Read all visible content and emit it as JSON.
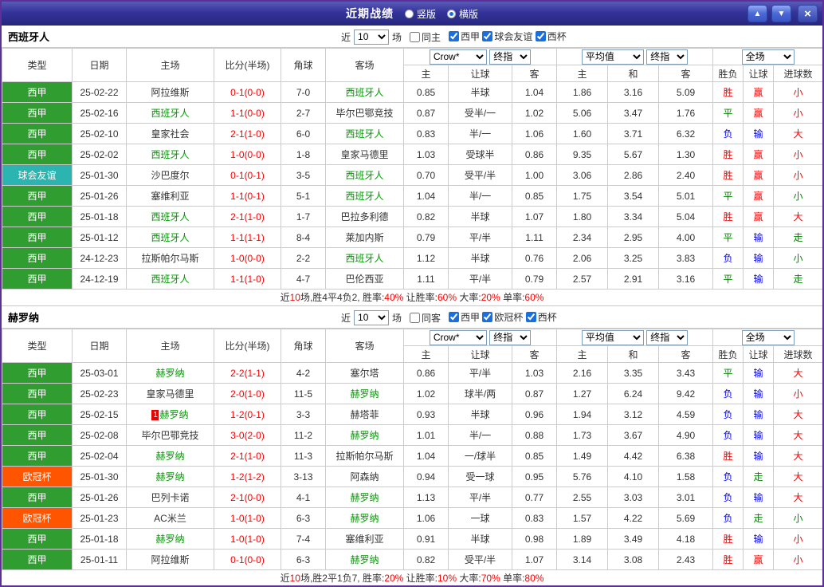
{
  "titlebar": {
    "title": "近期战绩",
    "radios": [
      {
        "label": "竖版",
        "selected": false
      },
      {
        "label": "横版",
        "selected": true
      }
    ],
    "buttons": {
      "up": "▲",
      "down": "▼",
      "close": "×"
    }
  },
  "filter": {
    "near_label": "近",
    "count": "10",
    "matches_label": "场"
  },
  "columns": {
    "type": "类型",
    "date": "日期",
    "home": "主场",
    "score_half": "比分(半场)",
    "corners": "角球",
    "away": "客场",
    "company_select": "Crow*",
    "final_select": "终指",
    "avg_select": "平均值",
    "scope_select": "全场",
    "odds_home": "主",
    "odds_handicap": "让球",
    "odds_away": "客",
    "avg_home": "主",
    "avg_draw": "和",
    "avg_away": "客",
    "result": "胜负",
    "handicap_result": "让球",
    "goals": "进球数"
  },
  "colors": {
    "laliga_bg": "#2f9d2f",
    "friendly_bg": "#2cb5b0",
    "ucl_bg": "#ff5500",
    "focal_team": "#009900",
    "score": "#ff0000",
    "win_red": "#ff0000",
    "draw_green": "#008800",
    "lose_blue": "#0000ee",
    "titlebar_bg": "#33339a",
    "page_border": "#5e2f96"
  },
  "tables": [
    {
      "team": "西班牙人",
      "same_venue_label": "同主",
      "same_venue_checked": false,
      "leagues": [
        {
          "label": "西甲",
          "checked": true
        },
        {
          "label": "球会友谊",
          "checked": true
        },
        {
          "label": "西杯",
          "checked": true
        }
      ],
      "rows": [
        {
          "league": "西甲",
          "league_color": "laliga",
          "date": "25-02-22",
          "home": "阿拉维斯",
          "home_color": "",
          "badge": "",
          "score": "0-1(0-0)",
          "corners": "7-0",
          "away": "西班牙人",
          "away_color": "focal",
          "odds": [
            "0.85",
            "半球",
            "1.04"
          ],
          "avg": [
            "1.86",
            "3.16",
            "5.09"
          ],
          "res": [
            {
              "t": "胜",
              "c": "red"
            },
            {
              "t": "赢",
              "c": "red"
            },
            {
              "t": "小",
              "c": "red"
            }
          ]
        },
        {
          "league": "西甲",
          "league_color": "laliga",
          "date": "25-02-16",
          "home": "西班牙人",
          "home_color": "focal",
          "badge": "",
          "score": "1-1(0-0)",
          "corners": "2-7",
          "away": "毕尔巴鄂竞技",
          "away_color": "",
          "odds": [
            "0.87",
            "受半/一",
            "1.02"
          ],
          "avg": [
            "5.06",
            "3.47",
            "1.76"
          ],
          "res": [
            {
              "t": "平",
              "c": "green"
            },
            {
              "t": "赢",
              "c": "red"
            },
            {
              "t": "小",
              "c": "red"
            }
          ]
        },
        {
          "league": "西甲",
          "league_color": "laliga",
          "date": "25-02-10",
          "home": "皇家社会",
          "home_color": "",
          "badge": "",
          "score": "2-1(1-0)",
          "corners": "6-0",
          "away": "西班牙人",
          "away_color": "focal",
          "odds": [
            "0.83",
            "半/一",
            "1.06"
          ],
          "avg": [
            "1.60",
            "3.71",
            "6.32"
          ],
          "res": [
            {
              "t": "负",
              "c": "blue"
            },
            {
              "t": "输",
              "c": "blue"
            },
            {
              "t": "大",
              "c": "red"
            }
          ]
        },
        {
          "league": "西甲",
          "league_color": "laliga",
          "date": "25-02-02",
          "home": "西班牙人",
          "home_color": "focal",
          "badge": "",
          "score": "1-0(0-0)",
          "corners": "1-8",
          "away": "皇家马德里",
          "away_color": "",
          "odds": [
            "1.03",
            "受球半",
            "0.86"
          ],
          "avg": [
            "9.35",
            "5.67",
            "1.30"
          ],
          "res": [
            {
              "t": "胜",
              "c": "red"
            },
            {
              "t": "赢",
              "c": "red"
            },
            {
              "t": "小",
              "c": "red"
            }
          ]
        },
        {
          "league": "球会友谊",
          "league_color": "friendly",
          "date": "25-01-30",
          "home": "沙巴度尔",
          "home_color": "",
          "badge": "",
          "score": "0-1(0-1)",
          "corners": "3-5",
          "away": "西班牙人",
          "away_color": "focal",
          "odds": [
            "0.70",
            "受平/半",
            "1.00"
          ],
          "avg": [
            "3.06",
            "2.86",
            "2.40"
          ],
          "res": [
            {
              "t": "胜",
              "c": "red"
            },
            {
              "t": "赢",
              "c": "red"
            },
            {
              "t": "小",
              "c": "red"
            }
          ]
        },
        {
          "league": "西甲",
          "league_color": "laliga",
          "date": "25-01-26",
          "home": "塞维利亚",
          "home_color": "",
          "badge": "",
          "score": "1-1(0-1)",
          "corners": "5-1",
          "away": "西班牙人",
          "away_color": "focal",
          "odds": [
            "1.04",
            "半/一",
            "0.85"
          ],
          "avg": [
            "1.75",
            "3.54",
            "5.01"
          ],
          "res": [
            {
              "t": "平",
              "c": "green"
            },
            {
              "t": "赢",
              "c": "red"
            },
            {
              "t": "小",
              "c": "green"
            }
          ]
        },
        {
          "league": "西甲",
          "league_color": "laliga",
          "date": "25-01-18",
          "home": "西班牙人",
          "home_color": "focal",
          "badge": "",
          "score": "2-1(1-0)",
          "corners": "1-7",
          "away": "巴拉多利德",
          "away_color": "",
          "odds": [
            "0.82",
            "半球",
            "1.07"
          ],
          "avg": [
            "1.80",
            "3.34",
            "5.04"
          ],
          "res": [
            {
              "t": "胜",
              "c": "red"
            },
            {
              "t": "赢",
              "c": "red"
            },
            {
              "t": "大",
              "c": "red"
            }
          ]
        },
        {
          "league": "西甲",
          "league_color": "laliga",
          "date": "25-01-12",
          "home": "西班牙人",
          "home_color": "focal",
          "badge": "",
          "score": "1-1(1-1)",
          "corners": "8-4",
          "away": "莱加内斯",
          "away_color": "",
          "odds": [
            "0.79",
            "平/半",
            "1.11"
          ],
          "avg": [
            "2.34",
            "2.95",
            "4.00"
          ],
          "res": [
            {
              "t": "平",
              "c": "green"
            },
            {
              "t": "输",
              "c": "blue"
            },
            {
              "t": "走",
              "c": "green"
            }
          ]
        },
        {
          "league": "西甲",
          "league_color": "laliga",
          "date": "24-12-23",
          "home": "拉斯帕尔马斯",
          "home_color": "",
          "badge": "",
          "score": "1-0(0-0)",
          "corners": "2-2",
          "away": "西班牙人",
          "away_color": "focal",
          "odds": [
            "1.12",
            "半球",
            "0.76"
          ],
          "avg": [
            "2.06",
            "3.25",
            "3.83"
          ],
          "res": [
            {
              "t": "负",
              "c": "blue"
            },
            {
              "t": "输",
              "c": "blue"
            },
            {
              "t": "小",
              "c": "green"
            }
          ]
        },
        {
          "league": "西甲",
          "league_color": "laliga",
          "date": "24-12-19",
          "home": "西班牙人",
          "home_color": "focal",
          "badge": "",
          "score": "1-1(1-0)",
          "corners": "4-7",
          "away": "巴伦西亚",
          "away_color": "",
          "odds": [
            "1.11",
            "平/半",
            "0.79"
          ],
          "avg": [
            "2.57",
            "2.91",
            "3.16"
          ],
          "res": [
            {
              "t": "平",
              "c": "green"
            },
            {
              "t": "输",
              "c": "blue"
            },
            {
              "t": "走",
              "c": "green"
            }
          ]
        }
      ],
      "footer": [
        {
          "t": "近",
          "c": "k"
        },
        {
          "t": "10",
          "c": "r"
        },
        {
          "t": "场,胜4平4负2, 胜率:",
          "c": "k"
        },
        {
          "t": "40%",
          "c": "r"
        },
        {
          "t": " 让胜率:",
          "c": "k"
        },
        {
          "t": "60%",
          "c": "r"
        },
        {
          "t": " 大率:",
          "c": "k"
        },
        {
          "t": "20%",
          "c": "r"
        },
        {
          "t": " 单率:",
          "c": "k"
        },
        {
          "t": "60%",
          "c": "r"
        }
      ]
    },
    {
      "team": "赫罗纳",
      "same_venue_label": "同客",
      "same_venue_checked": false,
      "leagues": [
        {
          "label": "西甲",
          "checked": true
        },
        {
          "label": "欧冠杯",
          "checked": true
        },
        {
          "label": "西杯",
          "checked": true
        }
      ],
      "rows": [
        {
          "league": "西甲",
          "league_color": "laliga",
          "date": "25-03-01",
          "home": "赫罗纳",
          "home_color": "focal",
          "badge": "",
          "score": "2-2(1-1)",
          "corners": "4-2",
          "away": "塞尔塔",
          "away_color": "",
          "odds": [
            "0.86",
            "平/半",
            "1.03"
          ],
          "avg": [
            "2.16",
            "3.35",
            "3.43"
          ],
          "res": [
            {
              "t": "平",
              "c": "green"
            },
            {
              "t": "输",
              "c": "blue"
            },
            {
              "t": "大",
              "c": "red"
            }
          ]
        },
        {
          "league": "西甲",
          "league_color": "laliga",
          "date": "25-02-23",
          "home": "皇家马德里",
          "home_color": "",
          "badge": "",
          "score": "2-0(1-0)",
          "corners": "11-5",
          "away": "赫罗纳",
          "away_color": "focal",
          "odds": [
            "1.02",
            "球半/两",
            "0.87"
          ],
          "avg": [
            "1.27",
            "6.24",
            "9.42"
          ],
          "res": [
            {
              "t": "负",
              "c": "blue"
            },
            {
              "t": "输",
              "c": "blue"
            },
            {
              "t": "小",
              "c": "red"
            }
          ]
        },
        {
          "league": "西甲",
          "league_color": "laliga",
          "date": "25-02-15",
          "home": "赫罗纳",
          "home_color": "focal",
          "badge": "1",
          "score": "1-2(0-1)",
          "corners": "3-3",
          "away": "赫塔菲",
          "away_color": "",
          "odds": [
            "0.93",
            "半球",
            "0.96"
          ],
          "avg": [
            "1.94",
            "3.12",
            "4.59"
          ],
          "res": [
            {
              "t": "负",
              "c": "blue"
            },
            {
              "t": "输",
              "c": "blue"
            },
            {
              "t": "大",
              "c": "red"
            }
          ]
        },
        {
          "league": "西甲",
          "league_color": "laliga",
          "date": "25-02-08",
          "home": "毕尔巴鄂竞技",
          "home_color": "",
          "badge": "",
          "score": "3-0(2-0)",
          "corners": "11-2",
          "away": "赫罗纳",
          "away_color": "focal",
          "odds": [
            "1.01",
            "半/一",
            "0.88"
          ],
          "avg": [
            "1.73",
            "3.67",
            "4.90"
          ],
          "res": [
            {
              "t": "负",
              "c": "blue"
            },
            {
              "t": "输",
              "c": "blue"
            },
            {
              "t": "大",
              "c": "red"
            }
          ]
        },
        {
          "league": "西甲",
          "league_color": "laliga",
          "date": "25-02-04",
          "home": "赫罗纳",
          "home_color": "focal",
          "badge": "",
          "score": "2-1(1-0)",
          "corners": "11-3",
          "away": "拉斯帕尔马斯",
          "away_color": "",
          "odds": [
            "1.04",
            "一/球半",
            "0.85"
          ],
          "avg": [
            "1.49",
            "4.42",
            "6.38"
          ],
          "res": [
            {
              "t": "胜",
              "c": "red"
            },
            {
              "t": "输",
              "c": "blue"
            },
            {
              "t": "大",
              "c": "red"
            }
          ]
        },
        {
          "league": "欧冠杯",
          "league_color": "ucl",
          "date": "25-01-30",
          "home": "赫罗纳",
          "home_color": "focal",
          "badge": "",
          "score": "1-2(1-2)",
          "corners": "3-13",
          "away": "阿森纳",
          "away_color": "",
          "odds": [
            "0.94",
            "受一球",
            "0.95"
          ],
          "avg": [
            "5.76",
            "4.10",
            "1.58"
          ],
          "res": [
            {
              "t": "负",
              "c": "blue"
            },
            {
              "t": "走",
              "c": "green"
            },
            {
              "t": "大",
              "c": "red"
            }
          ]
        },
        {
          "league": "西甲",
          "league_color": "laliga",
          "date": "25-01-26",
          "home": "巴列卡诺",
          "home_color": "",
          "badge": "",
          "score": "2-1(0-0)",
          "corners": "4-1",
          "away": "赫罗纳",
          "away_color": "focal",
          "odds": [
            "1.13",
            "平/半",
            "0.77"
          ],
          "avg": [
            "2.55",
            "3.03",
            "3.01"
          ],
          "res": [
            {
              "t": "负",
              "c": "blue"
            },
            {
              "t": "输",
              "c": "blue"
            },
            {
              "t": "大",
              "c": "red"
            }
          ]
        },
        {
          "league": "欧冠杯",
          "league_color": "ucl",
          "date": "25-01-23",
          "home": "AC米兰",
          "home_color": "",
          "badge": "",
          "score": "1-0(1-0)",
          "corners": "6-3",
          "away": "赫罗纳",
          "away_color": "focal",
          "odds": [
            "1.06",
            "一球",
            "0.83"
          ],
          "avg": [
            "1.57",
            "4.22",
            "5.69"
          ],
          "res": [
            {
              "t": "负",
              "c": "blue"
            },
            {
              "t": "走",
              "c": "green"
            },
            {
              "t": "小",
              "c": "green"
            }
          ]
        },
        {
          "league": "西甲",
          "league_color": "laliga",
          "date": "25-01-18",
          "home": "赫罗纳",
          "home_color": "focal",
          "badge": "",
          "score": "1-0(1-0)",
          "corners": "7-4",
          "away": "塞维利亚",
          "away_color": "",
          "odds": [
            "0.91",
            "半球",
            "0.98"
          ],
          "avg": [
            "1.89",
            "3.49",
            "4.18"
          ],
          "res": [
            {
              "t": "胜",
              "c": "red"
            },
            {
              "t": "输",
              "c": "blue"
            },
            {
              "t": "小",
              "c": "red"
            }
          ]
        },
        {
          "league": "西甲",
          "league_color": "laliga",
          "date": "25-01-11",
          "home": "阿拉维斯",
          "home_color": "",
          "badge": "",
          "score": "0-1(0-0)",
          "corners": "6-3",
          "away": "赫罗纳",
          "away_color": "focal",
          "odds": [
            "0.82",
            "受平/半",
            "1.07"
          ],
          "avg": [
            "3.14",
            "3.08",
            "2.43"
          ],
          "res": [
            {
              "t": "胜",
              "c": "red"
            },
            {
              "t": "赢",
              "c": "red"
            },
            {
              "t": "小",
              "c": "red"
            }
          ]
        }
      ],
      "footer": [
        {
          "t": "近",
          "c": "k"
        },
        {
          "t": "10",
          "c": "r"
        },
        {
          "t": "场,胜2平1负7, 胜率:",
          "c": "k"
        },
        {
          "t": "20%",
          "c": "r"
        },
        {
          "t": " 让胜率:",
          "c": "k"
        },
        {
          "t": "10%",
          "c": "r"
        },
        {
          "t": " 大率:",
          "c": "k"
        },
        {
          "t": "70%",
          "c": "r"
        },
        {
          "t": " 单率:",
          "c": "k"
        },
        {
          "t": "80%",
          "c": "r"
        }
      ]
    }
  ]
}
